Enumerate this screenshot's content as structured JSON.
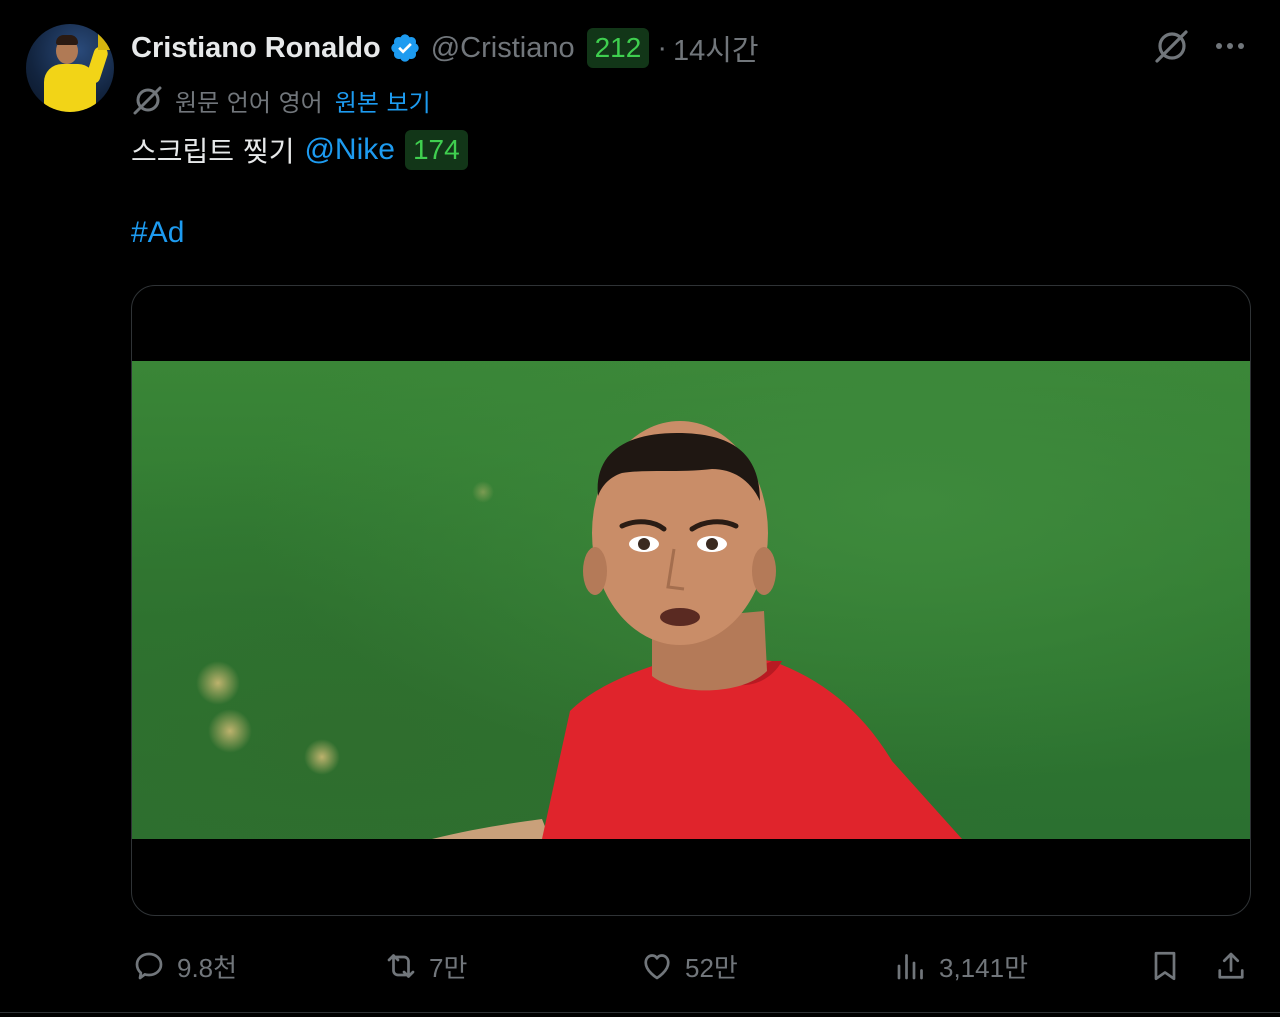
{
  "author": {
    "name": "Cristiano Ronaldo",
    "handle": "@Cristiano",
    "handle_badge": "212",
    "separator": "·",
    "time": "14시간",
    "verified_color": "#1d9bf0"
  },
  "translation": {
    "note": "원문 언어 영어",
    "link": "원본 보기"
  },
  "body": {
    "text": "스크립트 찢기",
    "mention": "@Nike",
    "mention_badge": "174",
    "hashtag": "#Ad"
  },
  "media": {
    "type": "video",
    "icon": "video-frame"
  },
  "actions": {
    "replies": "9.8천",
    "reposts": "7만",
    "likes": "52만",
    "views": "3,141만"
  },
  "icons": {
    "grok": "grok-icon",
    "more": "more-icon",
    "translate": "translate-icon",
    "reply": "reply-icon",
    "repost": "repost-icon",
    "like": "heart-icon",
    "views": "views-icon",
    "bookmark": "bookmark-icon",
    "share": "share-icon"
  },
  "colors": {
    "link": "#1d9bf0",
    "muted": "#71767b",
    "badge_text": "#3fcf4f",
    "badge_bg": "#123618"
  }
}
